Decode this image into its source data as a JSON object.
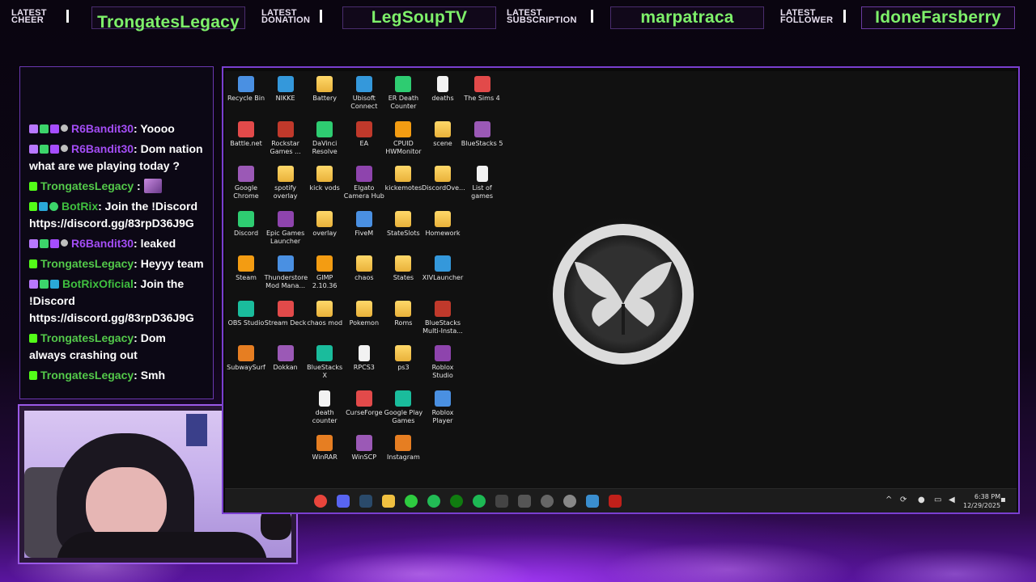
{
  "topbar": {
    "stats": [
      {
        "label_1": "LATEST",
        "label_2": "CHEER",
        "name": "TrongatesLegacy"
      },
      {
        "label_1": "LATEST",
        "label_2": "DONATION",
        "name": "LegSoupTV"
      },
      {
        "label_1": "LATEST",
        "label_2": "SUBSCRIPTION",
        "name": "marpatraca"
      },
      {
        "label_1": "LATEST",
        "label_2": "FOLLOWER",
        "name": "IdoneFarsberry"
      }
    ]
  },
  "chat": {
    "messages": [
      {
        "user": "R6Bandit30",
        "text": ": Yoooo"
      },
      {
        "user": "R6Bandit30",
        "text": ": Dom nation what are we playing today ?"
      },
      {
        "user": "TrongatesLegacy",
        "text": " :"
      },
      {
        "user": "BotRix",
        "text": ": Join the !Discord https://discord.gg/83rpD36J9G"
      },
      {
        "user": "R6Bandit30",
        "text": ": leaked"
      },
      {
        "user": "TrongatesLegacy",
        "text": ": Heyyy team"
      },
      {
        "user": "BotRixOficial",
        "text": ": Join the !Discord https://discord.gg/83rpD36J9G"
      },
      {
        "user": "TrongatesLegacy",
        "text": ": Dom always crashing out"
      },
      {
        "user": "TrongatesLegacy",
        "text": ": Smh"
      }
    ]
  },
  "desktop": {
    "icons": [
      "Recycle Bin",
      "NIKKE",
      "Battery",
      "Ubisoft Connect",
      "ER Death Counter",
      "deaths",
      "The Sims 4",
      "Battle.net",
      "Rockstar Games ...",
      "DaVinci Resolve",
      "EA",
      "CPUID HWMonitor",
      "scene",
      "BlueStacks 5",
      "Google Chrome",
      "spotify overlay",
      "kick vods",
      "Elgato Camera Hub",
      "kickemotes",
      "DiscordOve...",
      "List of games",
      "Discord",
      "Epic Games Launcher",
      "overlay",
      "FiveM",
      "StateSlots",
      "Homework",
      "Steam",
      "Thunderstore Mod Mana...",
      "GIMP 2.10.36",
      "chaos",
      "States",
      "XIVLauncher",
      "OBS Studio",
      "Stream Deck",
      "chaos mod",
      "Pokemon",
      "Roms",
      "BlueStacks Multi-Insta...",
      "SubwaySurf",
      "Dokkan",
      "BlueStacks X",
      "RPCS3",
      "ps3",
      "Roblox Studio",
      "death counter",
      "CurseForge",
      "Google Play Games",
      "Roblox Player",
      "WinRAR",
      "WinSCP",
      "Instagram"
    ]
  },
  "taskbar": {
    "time": "6:38 PM",
    "date": "12/29/2025"
  },
  "colors": {
    "accent_purple": "#7a3fd0",
    "stat_green": "#7ef06a",
    "chat_user_purple": "#a34df5",
    "chat_user_green": "#53c94a"
  }
}
